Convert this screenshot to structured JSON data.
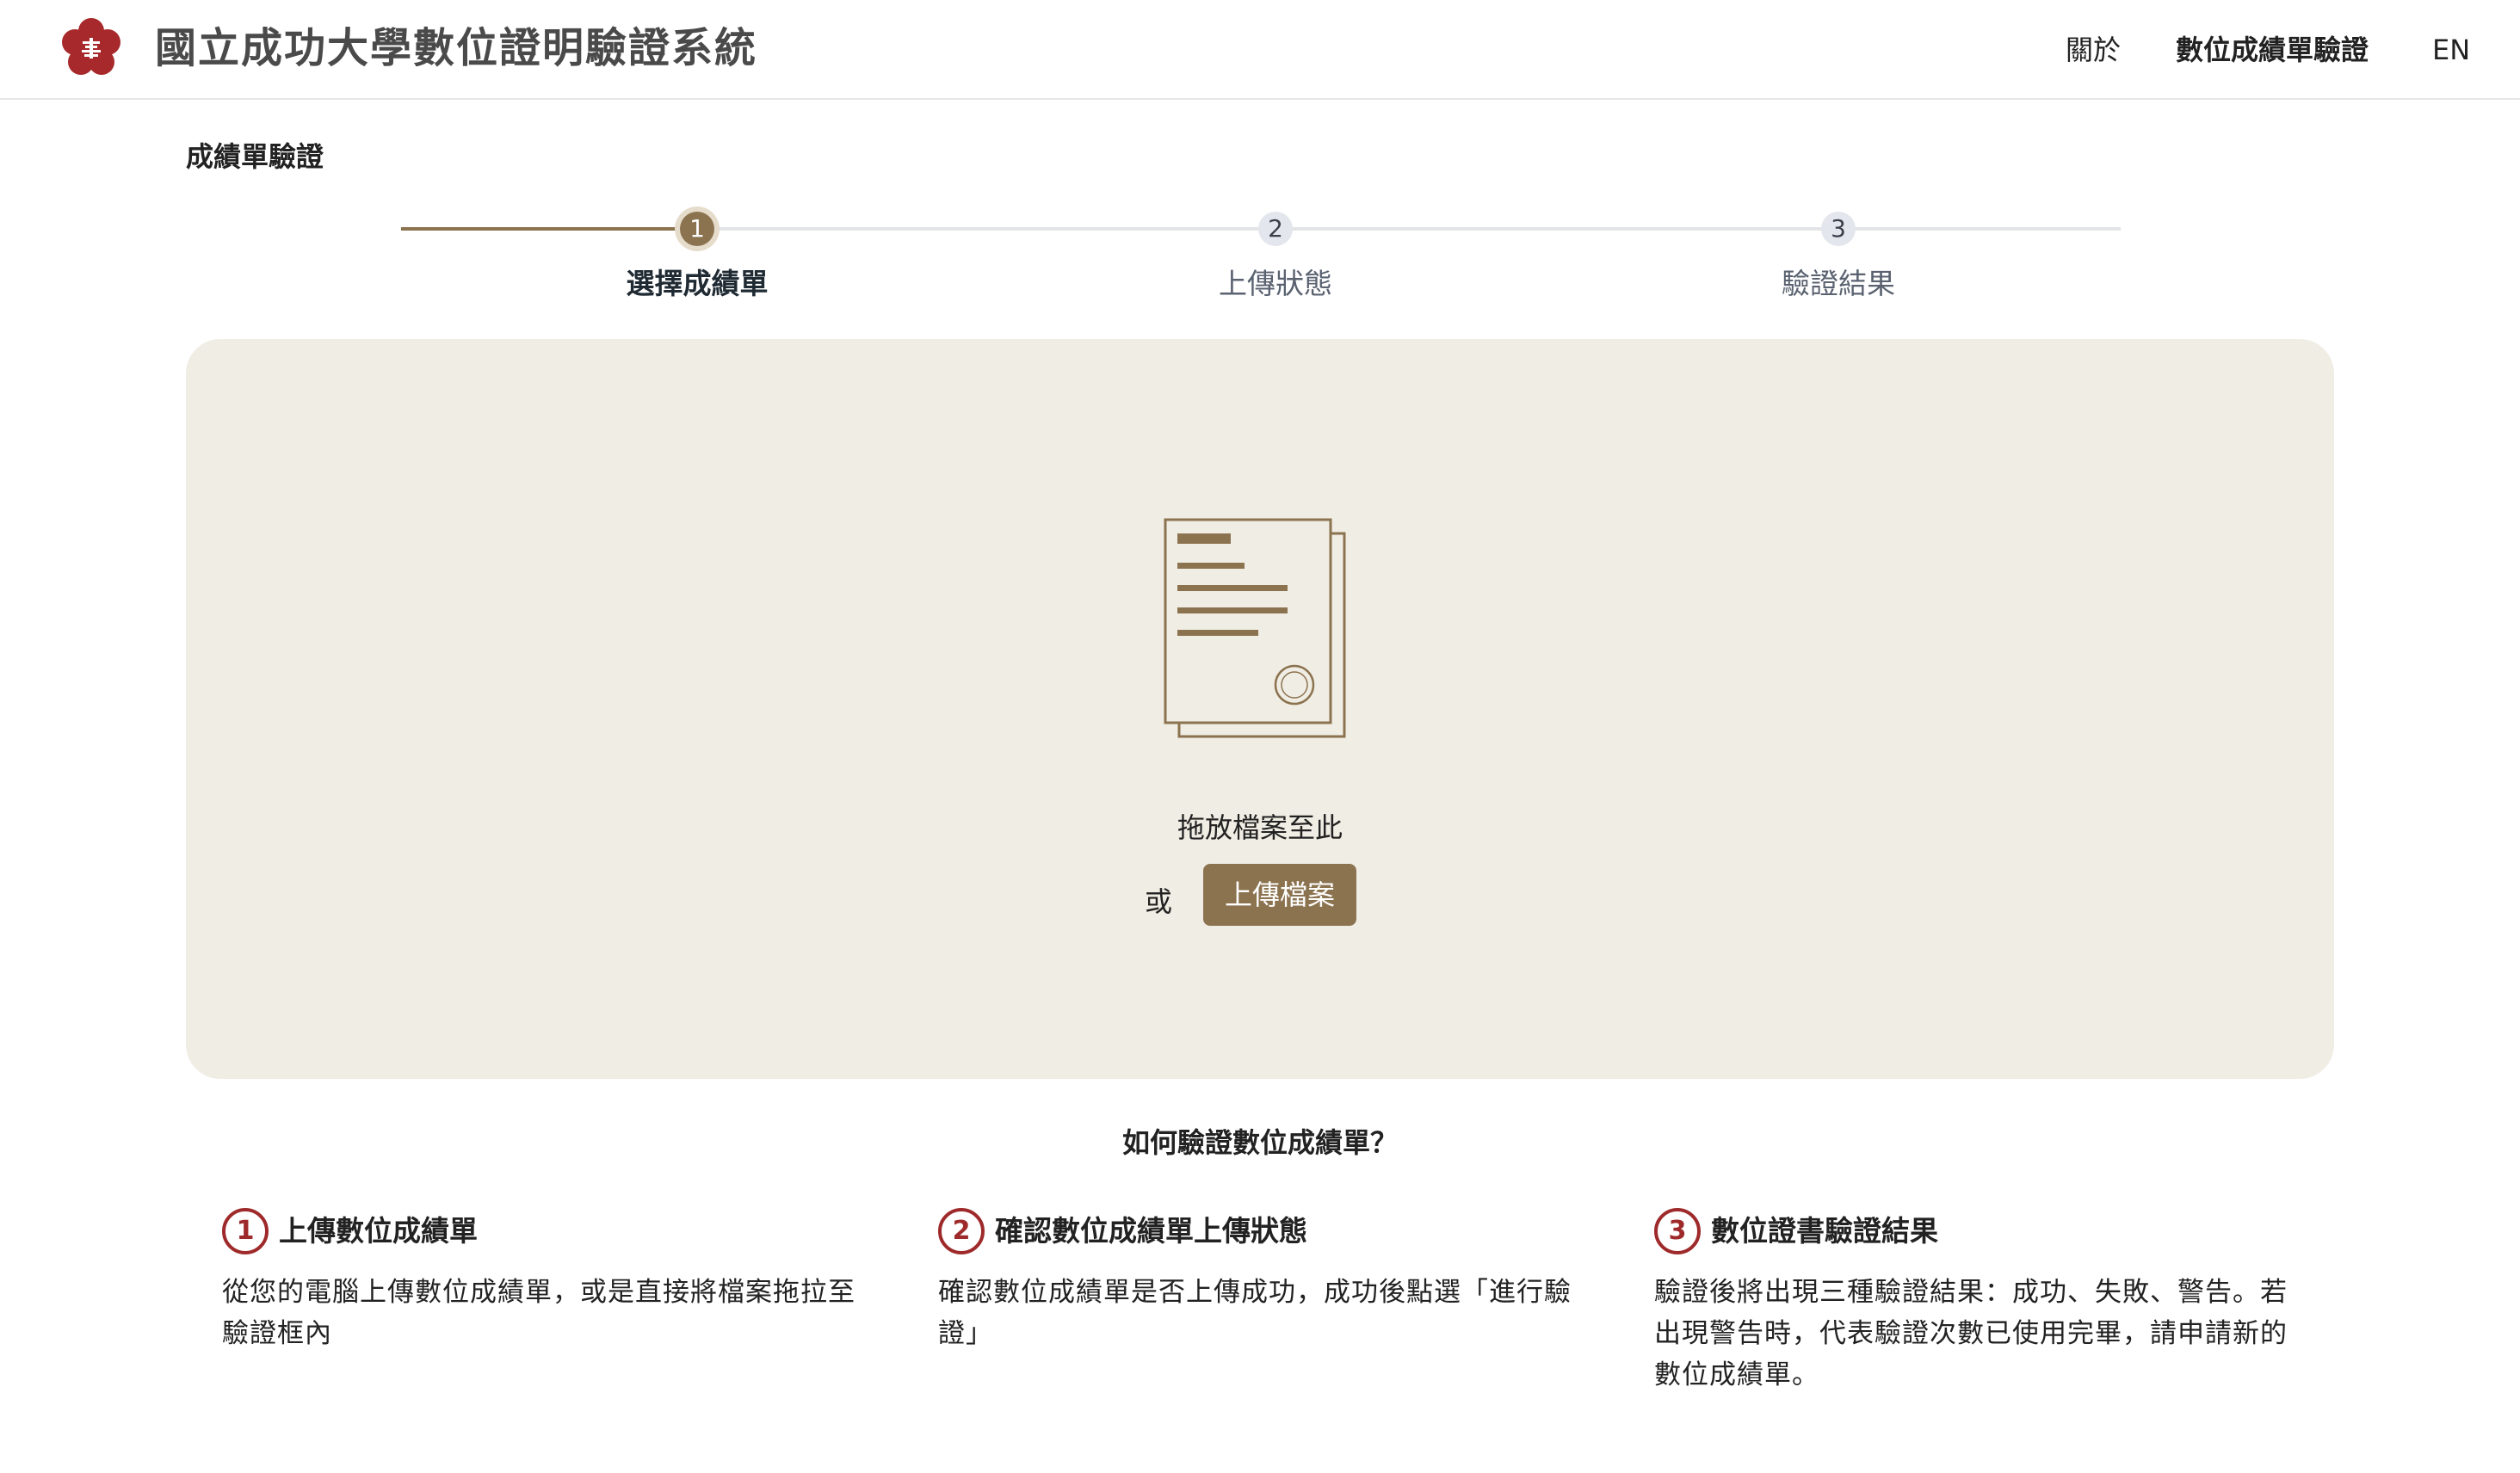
{
  "header": {
    "title": "國立成功大學數位證明驗證系統",
    "nav": {
      "about": "關於",
      "verify": "數位成績單驗證",
      "language": "EN"
    }
  },
  "page": {
    "section_label": "成績單驗證"
  },
  "stepper": {
    "current_step": 1,
    "steps": [
      {
        "number": "1",
        "label": "選擇成績單"
      },
      {
        "number": "2",
        "label": "上傳狀態"
      },
      {
        "number": "3",
        "label": "驗證結果"
      }
    ]
  },
  "dropzone": {
    "drop_text": "拖放檔案至此",
    "or_text": "或",
    "upload_button": "上傳檔案"
  },
  "howto": {
    "title": "如何驗證數位成績單？",
    "items": [
      {
        "number": "1",
        "heading": "上傳數位成績單",
        "description": "從您的電腦上傳數位成績單，或是直接將檔案拖拉至驗證框內"
      },
      {
        "number": "2",
        "heading": "確認數位成績單上傳狀態",
        "description": "確認數位成績單是否上傳成功，成功後點選「進行驗證」"
      },
      {
        "number": "3",
        "heading": "數位證書驗證結果",
        "description": "驗證後將出現三種驗證結果：成功、失敗、警告。若出現警告時，代表驗證次數已使用完畢，請申請新的數位成績單。"
      }
    ]
  },
  "colors": {
    "accent": "#8c7350",
    "dropzone_bg": "#f0ede4",
    "logo_red": "#a7292b",
    "howto_number": "#9e2a2b",
    "step_inactive": "#e3e6ec"
  },
  "icons": {
    "logo": "ncku-flower-logo",
    "document": "transcript-document-icon"
  }
}
